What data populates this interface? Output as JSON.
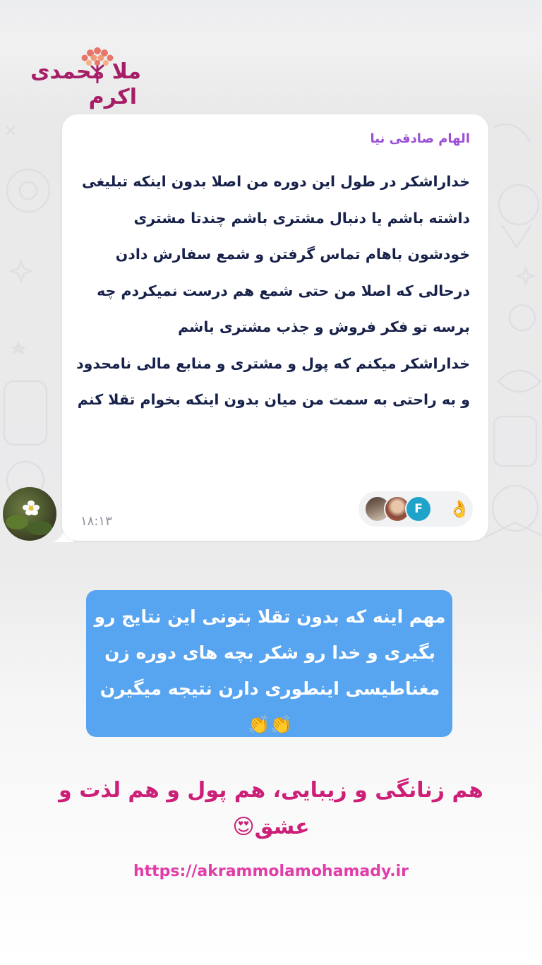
{
  "logo": {
    "line1": "ملا محمدی",
    "line2": "اکرم",
    "brand_color": "#a61f66"
  },
  "message": {
    "sender": "الهام صادقی نیا",
    "text": "خداراشکر در طول این دوره من اصلا بدون اینکه تبلیغی داشته باشم یا دنبال مشتری باشم چندتا مشتری خودشون باهام تماس گرفتن و شمع سفارش دادن درحالی که اصلا من حتی شمع هم درست نمیکردم چه برسه تو فکر فروش و جذب مشتری باشم\nخداراشکر میکنم که پول و مشتری و منابع مالی نامحدود و به راحتی به سمت من میان بدون اینکه بخوام تقلا کنم",
    "time": "۱۸:۱۳",
    "reaction_emoji": "👌",
    "reaction_avatar_letter": "F"
  },
  "caption": {
    "text": "مهم اینه که بدون تقلا بتونی این نتایج رو بگیری و خدا رو شکر بچه های دوره زن مغناطیسی اینطوری دارن نتیجه میگیرن👏👏",
    "background_color": "#57a4f0"
  },
  "headline": {
    "text": "هم زنانگی و زیبایی، هم پول و هم لذت و عشق😍",
    "color": "#cc1f77"
  },
  "footer": {
    "url": "https://akrammolamohamady.ir"
  }
}
